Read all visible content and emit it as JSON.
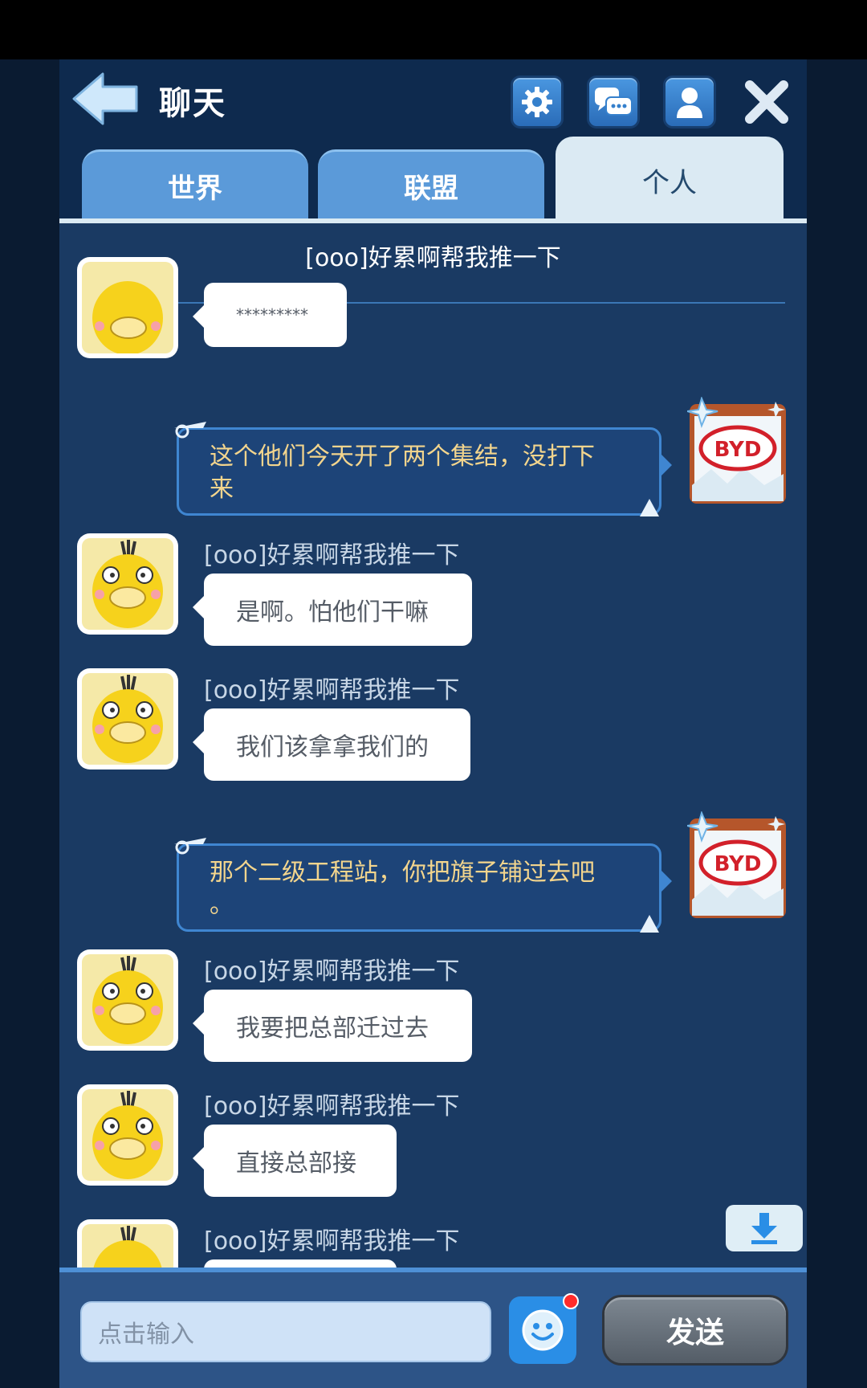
{
  "header": {
    "title": "聊天",
    "tabs": [
      {
        "label": "世界",
        "active": false
      },
      {
        "label": "联盟",
        "active": false
      },
      {
        "label": "个人",
        "active": true
      }
    ]
  },
  "conversation": {
    "title": "[ooo]好累啊帮我推一下"
  },
  "messages": [
    {
      "side": "left",
      "name": "",
      "text": "*********"
    },
    {
      "side": "right",
      "lines": [
        "这个他们今天开了两个集结，没打下",
        "来"
      ]
    },
    {
      "side": "left",
      "name": "[ooo]好累啊帮我推一下",
      "text": "是啊。怕他们干嘛"
    },
    {
      "side": "left",
      "name": "[ooo]好累啊帮我推一下",
      "text": "我们该拿拿我们的"
    },
    {
      "side": "right",
      "lines": [
        "那个二级工程站，你把旗子铺过去吧",
        "。"
      ]
    },
    {
      "side": "left",
      "name": "[ooo]好累啊帮我推一下",
      "text": "我要把总部迁过去"
    },
    {
      "side": "left",
      "name": "[ooo]好累啊帮我推一下",
      "text": "直接总部接"
    },
    {
      "side": "left",
      "name": "[ooo]好累啊帮我推一下",
      "text": ""
    }
  ],
  "my_avatar_logo": "BYD",
  "footer": {
    "input_placeholder": "点击输入",
    "send_label": "发送"
  },
  "icons": {
    "back": "back-arrow-icon",
    "settings": "gear-icon",
    "chat": "chat-bubbles-icon",
    "profile": "person-icon",
    "close": "close-icon",
    "scroll": "download-arrow-icon",
    "emoji": "smiley-icon"
  },
  "colors": {
    "panel_bg": "#1a3a63",
    "header_bg": "#0e2a4e",
    "my_text": "#f3d58d",
    "accent": "#4e90d6",
    "notification": "#ff2b2b"
  }
}
